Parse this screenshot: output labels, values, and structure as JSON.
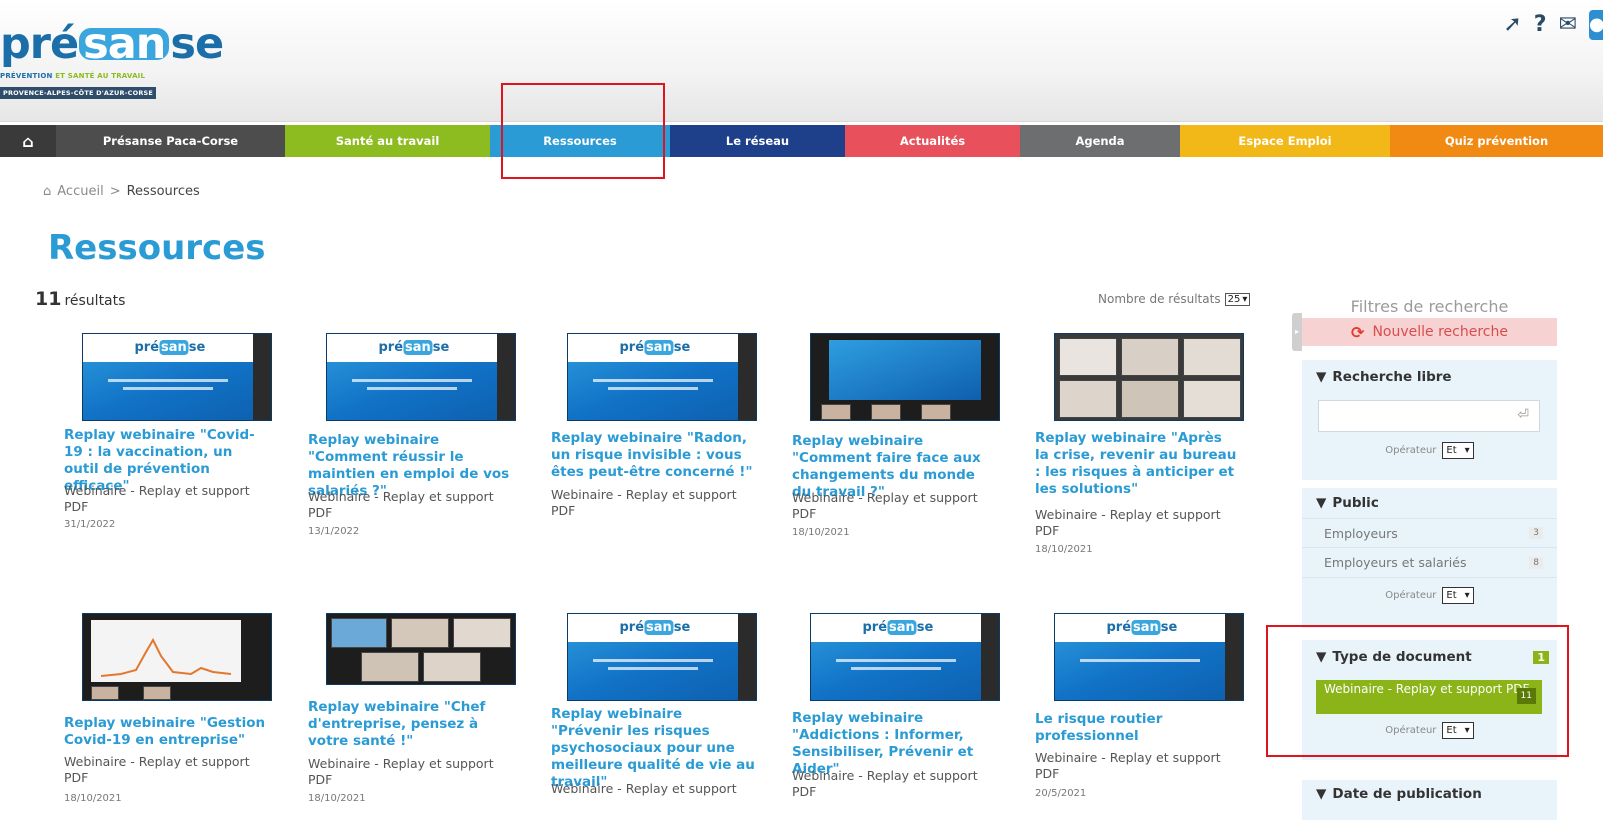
{
  "header": {
    "logo": {
      "pre": "pré",
      "san": "san",
      "se": "se",
      "tagline_a": "PRÉVENTION ",
      "tagline_b": "ET SANTÉ AU TRAVAIL",
      "region": "PROVENCE-ALPES-CÔTE D'AZUR-CORSE"
    },
    "icons": [
      "send-icon",
      "help-icon",
      "mail-icon",
      "user-icon"
    ]
  },
  "nav": {
    "items": [
      {
        "label": "Présanse Paca-Corse",
        "color": "#4d4d4d"
      },
      {
        "label": "Santé au travail",
        "color": "#8cbc20"
      },
      {
        "label": "Ressources",
        "color": "#2a9bd4"
      },
      {
        "label": "Le réseau",
        "color": "#1e3f8a"
      },
      {
        "label": "Actualités",
        "color": "#e8505b"
      },
      {
        "label": "Agenda",
        "color": "#6d6e70"
      },
      {
        "label": "Espace Emploi",
        "color": "#f2b818"
      },
      {
        "label": "Quiz prévention",
        "color": "#f08a12"
      }
    ]
  },
  "breadcrumb": {
    "home": "Accueil",
    "separator": ">",
    "current": "Ressources"
  },
  "page_title": "Ressources",
  "results": {
    "count": "11",
    "label": "résultats",
    "per_page_label": "Nombre de résultats",
    "per_page_value": "25"
  },
  "cards": [
    {
      "title": "Replay webinaire \"Covid-19 : la vaccination, un outil de prévention efficace\"",
      "type": "Webinaire - Replay et support PDF",
      "date": "31/1/2022"
    },
    {
      "title": "Replay webinaire \"Comment réussir le maintien en emploi de vos salariés ?\"",
      "type": "Webinaire - Replay et support PDF",
      "date": "13/1/2022"
    },
    {
      "title": "Replay webinaire \"Radon, un risque invisible : vous êtes peut-être concerné !\"",
      "type": "Webinaire - Replay et support PDF",
      "date": ""
    },
    {
      "title": "Replay webinaire \"Comment faire face aux changements du monde du travail ?\"",
      "type": "Webinaire - Replay et support PDF",
      "date": "18/10/2021"
    },
    {
      "title": "Replay webinaire \"Après la crise, revenir au bureau : les risques à anticiper et les solutions\"",
      "type": "Webinaire - Replay et support PDF",
      "date": "18/10/2021"
    },
    {
      "title": "Replay webinaire \"Gestion Covid-19 en entreprise\"",
      "type": "Webinaire - Replay et support PDF",
      "date": "18/10/2021"
    },
    {
      "title": "Replay webinaire \"Chef d'entreprise, pensez à votre santé !\"",
      "type": "Webinaire - Replay et support PDF",
      "date": "18/10/2021"
    },
    {
      "title": "Replay webinaire \"Prévenir les risques psychosociaux pour une meilleure qualité de vie au travail\"",
      "type": "Webinaire - Replay et support",
      "date": ""
    },
    {
      "title": "Replay webinaire \"Addictions : Informer, Sensibiliser, Prévenir et Aider\"",
      "type": "Webinaire - Replay et support PDF",
      "date": ""
    },
    {
      "title": "Le risque routier professionnel",
      "type": "Webinaire - Replay et support PDF",
      "date": "20/5/2021"
    }
  ],
  "sidebar": {
    "title": "Filtres de recherche",
    "new_search": "Nouvelle recherche",
    "free_search": {
      "heading": "Recherche libre",
      "operator_label": "Opérateur",
      "operator_value": "Et"
    },
    "public": {
      "heading": "Public",
      "items": [
        {
          "label": "Employeurs",
          "count": "3"
        },
        {
          "label": "Employeurs et salariés",
          "count": "8"
        }
      ],
      "operator_label": "Opérateur",
      "operator_value": "Et"
    },
    "doc_type": {
      "heading": "Type de document",
      "badge": "1",
      "active": {
        "label": "Webinaire - Replay et support PDF",
        "count": "11"
      },
      "operator_label": "Opérateur",
      "operator_value": "Et"
    },
    "date": {
      "heading": "Date de publication"
    }
  }
}
